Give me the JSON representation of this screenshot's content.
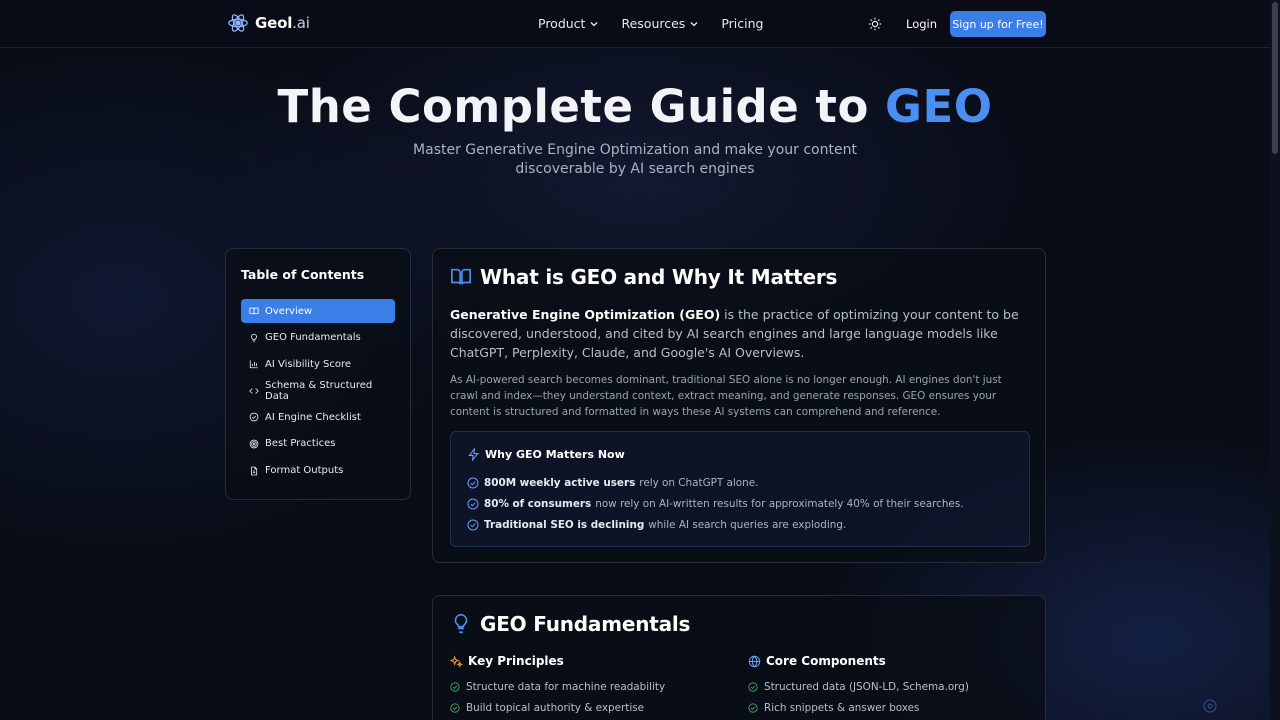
{
  "header": {
    "logo_name": "Geol",
    "logo_suffix": ".ai",
    "nav": [
      {
        "label": "Product"
      },
      {
        "label": "Resources"
      },
      {
        "label": "Pricing"
      }
    ],
    "login_label": "Login",
    "signup_label": "Sign up for Free!"
  },
  "hero": {
    "title_main": "The Complete Guide to ",
    "title_accent": "GEO",
    "subtitle": "Master Generative Engine Optimization and make your content discoverable by AI search engines"
  },
  "toc": {
    "title": "Table of Contents",
    "items": [
      {
        "label": "Overview",
        "icon": "book-icon"
      },
      {
        "label": "GEO Fundamentals",
        "icon": "lightbulb-icon"
      },
      {
        "label": "AI Visibility Score",
        "icon": "bar-chart-icon"
      },
      {
        "label": "Schema & Structured Data",
        "icon": "code-icon"
      },
      {
        "label": "AI Engine Checklist",
        "icon": "check-circle-icon"
      },
      {
        "label": "Best Practices",
        "icon": "target-icon"
      },
      {
        "label": "Format Outputs",
        "icon": "file-icon"
      }
    ]
  },
  "overview": {
    "heading": "What is GEO and Why It Matters",
    "lead_bold": "Generative Engine Optimization (GEO)",
    "lead_rest": " is the practice of optimizing your content to be discovered, understood, and cited by AI search engines and large language models like ChatGPT, Perplexity, Claude, and Google's AI Overviews.",
    "body": "As AI-powered search becomes dominant, traditional SEO alone is no longer enough. AI engines don't just crawl and index—they understand context, extract meaning, and generate responses. GEO ensures your content is structured and formatted in ways these AI systems can comprehend and reference.",
    "why": {
      "heading": "Why GEO Matters Now",
      "items": [
        {
          "bold": "800M weekly active users",
          "rest": "rely on ChatGPT alone."
        },
        {
          "bold": "80% of consumers",
          "rest": "now rely on AI-written results for approximately 40% of their searches."
        },
        {
          "bold": "Traditional SEO is declining",
          "rest": "while AI search queries are exploding."
        }
      ]
    }
  },
  "fundamentals": {
    "heading": "GEO Fundamentals",
    "left": {
      "heading": "Key Principles",
      "items": [
        "Structure data for machine readability",
        "Build topical authority & expertise"
      ]
    },
    "right": {
      "heading": "Core Components",
      "items": [
        "Structured data (JSON-LD, Schema.org)",
        "Rich snippets & answer boxes"
      ]
    }
  },
  "colors": {
    "accent": "#3a7ee8",
    "title_accent": "#4a8ef0",
    "background": "#090c16",
    "check_green": "#4caf6a"
  }
}
